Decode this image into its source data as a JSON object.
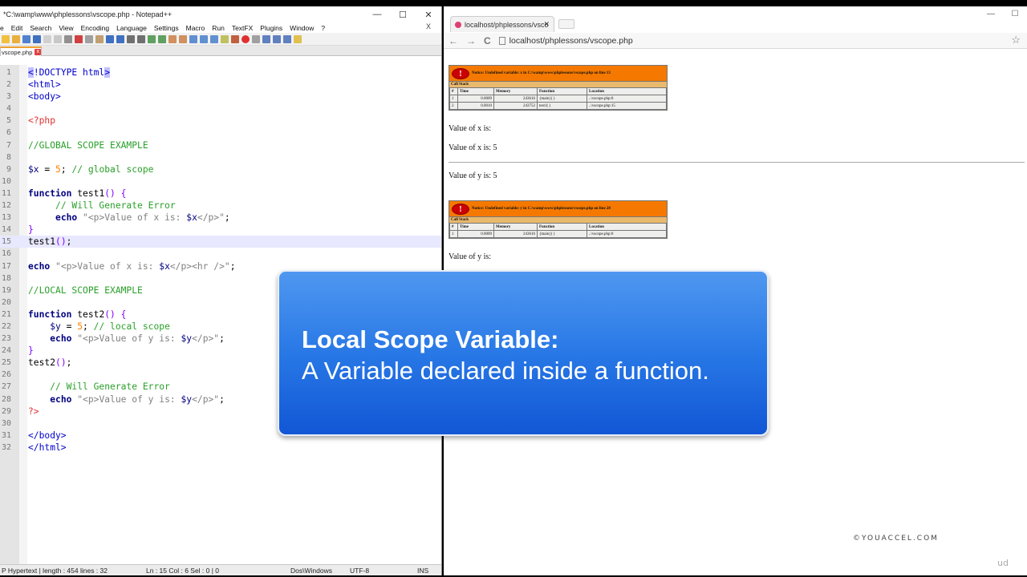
{
  "notepad": {
    "title": "*C:\\wamp\\www\\phplessons\\vscope.php - Notepad++",
    "window_controls": [
      "—",
      "☐",
      "✕"
    ],
    "menu": [
      "e",
      "Edit",
      "Search",
      "View",
      "Encoding",
      "Language",
      "Settings",
      "Macro",
      "Run",
      "TextFX",
      "Plugins",
      "Window",
      "?"
    ],
    "menu_close": "X",
    "tab_label": "vscope.php",
    "tab_close": "x",
    "status": {
      "type": "P Hypertext | length : 454    lines : 32",
      "position": "Ln : 15    Col : 6    Sel : 0 | 0",
      "eol": "Dos\\Windows",
      "encoding": "UTF-8",
      "mode": "INS"
    }
  },
  "browser": {
    "tab_title": "localhost/phplessons/vsco",
    "tab_close": "✕",
    "window_controls": [
      "—",
      "☐"
    ],
    "nav_back": "←",
    "nav_forward": "→",
    "nav_reload": "C",
    "url": "localhost/phplessons/vscope.php",
    "star": "☆",
    "errors": [
      {
        "message": "Notice: Undefined variable: x in C:\\wamp\\www\\phplessons\\vscope.php on line 13",
        "call_stack_label": "Call Stack",
        "headers": [
          "#",
          "Time",
          "Memory",
          "Function",
          "Location"
        ],
        "rows": [
          [
            "1",
            "0.0009",
            "243616",
            "{main}( )",
            "..\\vscope.php:0"
          ],
          [
            "2",
            "0.0010",
            "243752",
            "test1( )",
            "..\\vscope.php:15"
          ]
        ]
      },
      {
        "message": "Notice: Undefined variable: y in C:\\wamp\\www\\phplessons\\vscope.php on line 28",
        "call_stack_label": "Call Stack",
        "headers": [
          "#",
          "Time",
          "Memory",
          "Function",
          "Location"
        ],
        "rows": [
          [
            "1",
            "0.0009",
            "243616",
            "{main}( )",
            "..\\vscope.php:0"
          ]
        ]
      }
    ],
    "outputs": {
      "x_empty": "Value of x is:",
      "x_five": "Value of x is: 5",
      "y_five": "Value of y is: 5",
      "y_empty": "Value of y is:"
    },
    "watermark": "©YOUACCEL.COM",
    "udemy_mark": "ud"
  },
  "callout": {
    "heading": "Local Scope Variable:",
    "body": "A Variable declared inside a function."
  }
}
